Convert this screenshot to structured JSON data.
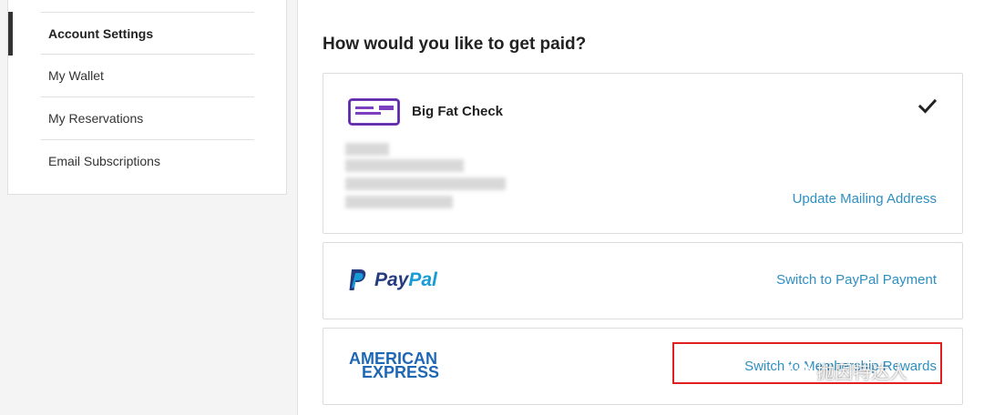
{
  "sidebar": {
    "items": [
      {
        "label": "Account Settings",
        "active": true
      },
      {
        "label": "My Wallet"
      },
      {
        "label": "My Reservations"
      },
      {
        "label": "Email Subscriptions"
      }
    ]
  },
  "main": {
    "title": "How would you like to get paid?",
    "options": {
      "check": {
        "title": "Big Fat Check",
        "selected": true,
        "link": "Update Mailing Address"
      },
      "paypal": {
        "logo_a": "Pay",
        "logo_b": "Pal",
        "link": "Switch to PayPal Payment"
      },
      "amex": {
        "logo_line1": "AMERICAN",
        "logo_line2": "EXPRESS",
        "link": "Switch to Membership Rewards"
      }
    }
  },
  "watermark": {
    "text": "抛因特达人"
  },
  "colors": {
    "link": "#2f8fc2",
    "highlight": "#e02020",
    "amex_blue": "#1e67b5",
    "paypal_dark": "#253b80",
    "paypal_light": "#179bd7",
    "check_purple": "#7b3fbf"
  }
}
